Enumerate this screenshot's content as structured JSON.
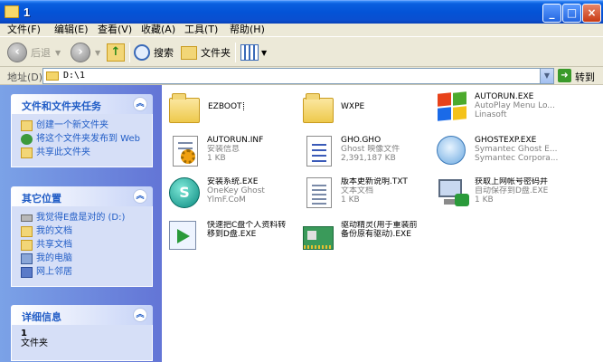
{
  "window": {
    "title": "1"
  },
  "menu": [
    "文件(F)",
    "编辑(E)",
    "查看(V)",
    "收藏(A)",
    "工具(T)",
    "帮助(H)"
  ],
  "toolbar": {
    "back": "后退",
    "search": "搜索",
    "folders": "文件夹"
  },
  "address": {
    "label": "地址(D)",
    "value": "D:\\1",
    "go": "转到"
  },
  "tasks": {
    "title": "文件和文件夹任务",
    "items": [
      "创建一个新文件夹",
      "将这个文件夹发布到 Web",
      "共享此文件夹"
    ]
  },
  "places": {
    "title": "其它位置",
    "items": [
      "我觉得E盘是对的 (D:)",
      "我的文档",
      "共享文档",
      "我的电脑",
      "网上邻居"
    ]
  },
  "details": {
    "title": "详细信息",
    "name": "1",
    "type": "文件夹"
  },
  "files": [
    {
      "name": "EZBOOT",
      "icon": "folder-icon"
    },
    {
      "name": "WXPE",
      "icon": "folder-icon"
    },
    {
      "name": "AUTORUN.EXE",
      "desc1": "AutoPlay Menu Lo...",
      "desc2": "Linasoft",
      "icon": "windows-logo-icon"
    },
    {
      "name": "AUTORUN.INF",
      "desc1": "安装信息",
      "desc2": "1 KB",
      "icon": "settings-file-icon"
    },
    {
      "name": "GHO.GHO",
      "desc1": "Ghost 映像文件",
      "desc2": "2,391,187 KB",
      "icon": "ghost-image-icon"
    },
    {
      "name": "GHOSTEXP.EXE",
      "desc1": "Symantec Ghost E...",
      "desc2": "Symantec Corpora...",
      "icon": "ghost-explorer-icon"
    },
    {
      "name": "安装系统.EXE",
      "desc1": "OneKey Ghost",
      "desc2": "YlmF.CoM",
      "icon": "onekey-ghost-icon"
    },
    {
      "name": "版本更新说明.TXT",
      "desc1": "文本文档",
      "desc2": "1 KB",
      "icon": "text-document-icon"
    },
    {
      "name": "获取上网帐号密码并",
      "name2": "自动保存到D盘.EXE",
      "desc1": "自动保存到D盘.EXE",
      "desc2": "1 KB",
      "icon": "network-computer-icon"
    },
    {
      "name": "快速把C盘个人资料转",
      "name2": "移到D盘.EXE",
      "icon": "transfer-icon"
    },
    {
      "name": "驱动精灵(用于重装前",
      "name2": "备份原有驱动).EXE",
      "icon": "driver-card-icon"
    }
  ]
}
